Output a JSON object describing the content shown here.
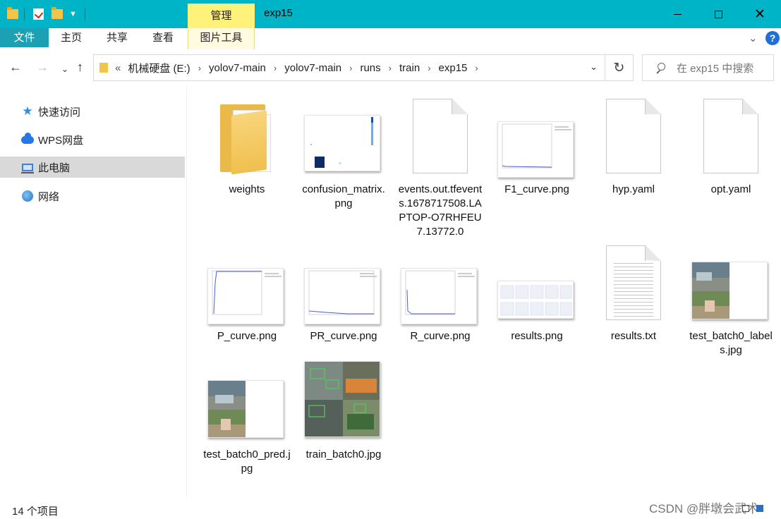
{
  "window": {
    "title": "exp15",
    "contextual_tab_group": "管理"
  },
  "ribbon": {
    "tabs": [
      "文件",
      "主页",
      "共享",
      "查看"
    ],
    "contextual_tab": "图片工具"
  },
  "navigation": {
    "path": [
      "机械硬盘 (E:)",
      "yolov7-main",
      "yolov7-main",
      "runs",
      "train",
      "exp15"
    ],
    "overflow_marker": "«",
    "search_placeholder": "在 exp15 中搜索"
  },
  "sidebar": {
    "items": [
      {
        "label": "快速访问",
        "icon": "star-icon",
        "selected": false
      },
      {
        "label": "WPS网盘",
        "icon": "cloud-icon",
        "selected": false
      },
      {
        "label": "此电脑",
        "icon": "computer-icon",
        "selected": true
      },
      {
        "label": "网络",
        "icon": "network-icon",
        "selected": false
      }
    ]
  },
  "files": [
    {
      "name": "weights",
      "kind": "folder"
    },
    {
      "name": "confusion_matrix.png",
      "kind": "image"
    },
    {
      "name": "events.out.tfevents.1678717508.LAPTOP-O7RHFEU7.13772.0",
      "kind": "file"
    },
    {
      "name": "F1_curve.png",
      "kind": "image"
    },
    {
      "name": "hyp.yaml",
      "kind": "file"
    },
    {
      "name": "opt.yaml",
      "kind": "file"
    },
    {
      "name": "P_curve.png",
      "kind": "image"
    },
    {
      "name": "PR_curve.png",
      "kind": "image"
    },
    {
      "name": "R_curve.png",
      "kind": "image"
    },
    {
      "name": "results.png",
      "kind": "image"
    },
    {
      "name": "results.txt",
      "kind": "text"
    },
    {
      "name": "test_batch0_labels.jpg",
      "kind": "image"
    },
    {
      "name": "test_batch0_pred.jpg",
      "kind": "image"
    },
    {
      "name": "train_batch0.jpg",
      "kind": "image"
    }
  ],
  "status": {
    "item_count": "14 个项目"
  },
  "watermark": "CSDN @胖墩会武术",
  "colors": {
    "titlebar": "#00b4c8",
    "file_tab": "#1ba0b4",
    "manage_tab": "#fff27a",
    "selection": "#d9d9d9",
    "folder": "#f0c04e"
  }
}
